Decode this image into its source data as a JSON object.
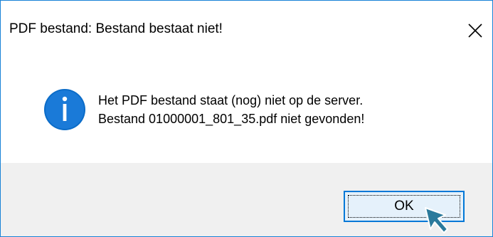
{
  "dialog": {
    "title": "PDF bestand: Bestand bestaat niet!",
    "close_icon": "close-icon",
    "message_icon": "info-icon",
    "message_lines": [
      "Het PDF bestand staat (nog) niet op de server.",
      "Bestand 01000001_801_35.pdf niet gevonden!"
    ],
    "ok_label": "OK"
  },
  "colors": {
    "window_border": "#1883d7",
    "footer_background": "#f0f0f0",
    "button_border": "#0078d7",
    "button_fill": "#e5f1fb",
    "info_icon": "#0b6cc8",
    "cursor": "#2b7a9c"
  }
}
